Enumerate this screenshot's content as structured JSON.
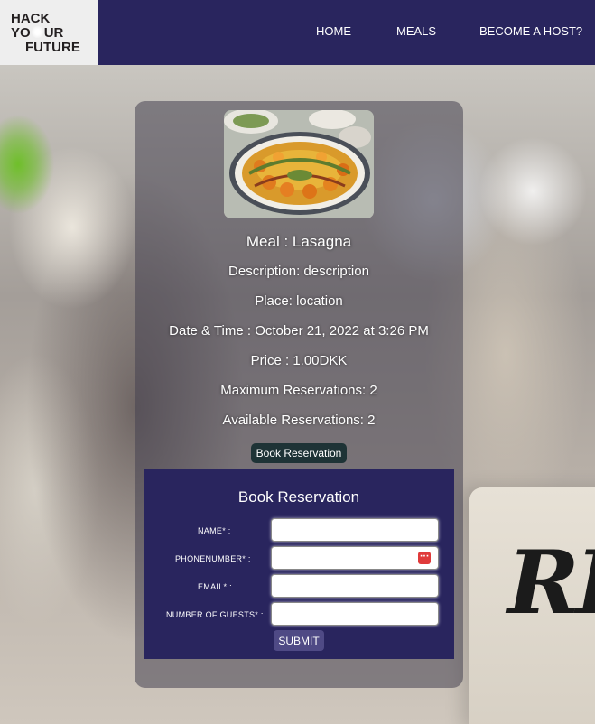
{
  "logo": {
    "line1": "HACK",
    "line2": "YO",
    "line2b": "UR",
    "line3": "FUTURE"
  },
  "nav": {
    "home": "HOME",
    "meals": "MEALS",
    "host": "BECOME A HOST?"
  },
  "meal": {
    "title": "Meal : Lasagna",
    "description": "Description: description",
    "place": "Place: location",
    "datetime": "Date & Time : October 21, 2022 at 3:26 PM",
    "price": "Price : 1.00DKK",
    "max_reservations": "Maximum Reservations: 2",
    "available_reservations": "Available Reservations: 2",
    "book_button": "Book Reservation"
  },
  "form": {
    "title": "Book Reservation",
    "name_label": "NAME* :",
    "phone_label": "PHONENUMBER* :",
    "email_label": "EMAIL* :",
    "guests_label": "NUMBER OF GUESTS* :",
    "name_value": "",
    "phone_value": "",
    "email_value": "",
    "guests_value": "",
    "submit": "SUBMIT"
  },
  "background_sign": "RI",
  "colors": {
    "nav": "#29255e",
    "form": "#29255e",
    "book_button": "#1e3336",
    "submit": "#4f4a85"
  }
}
